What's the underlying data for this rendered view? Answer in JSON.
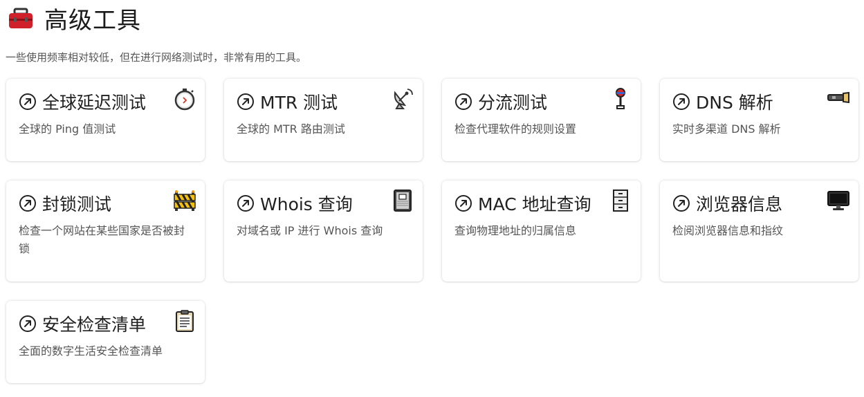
{
  "header": {
    "icon": "toolbox-icon",
    "title": "高级工具",
    "subtitle": "一些使用频率相对较低，但在进行网络测试时，非常有用的工具。"
  },
  "cards": [
    {
      "title": "全球延迟测试",
      "desc": "全球的 Ping 值测试",
      "icon": "stopwatch-icon"
    },
    {
      "title": "MTR 测试",
      "desc": "全球的 MTR 路由测试",
      "icon": "satellite-dish-icon"
    },
    {
      "title": "分流测试",
      "desc": "检查代理软件的规则设置",
      "icon": "round-pushpin-icon"
    },
    {
      "title": "DNS 解析",
      "desc": "实时多渠道 DNS 解析",
      "icon": "flashlight-icon"
    },
    {
      "title": "封锁测试",
      "desc": "检查一个网站在某些国家是否被封锁",
      "icon": "construction-barrier-icon"
    },
    {
      "title": "Whois 查询",
      "desc": "对域名或 IP 进行 Whois 查询",
      "icon": "notebook-icon"
    },
    {
      "title": "MAC 地址查询",
      "desc": "查询物理地址的归属信息",
      "icon": "file-cabinet-icon"
    },
    {
      "title": "浏览器信息",
      "desc": "检阅浏览器信息和指纹",
      "icon": "desktop-computer-icon"
    },
    {
      "title": "安全检查清单",
      "desc": "全面的数字生活安全检查清单",
      "icon": "clipboard-icon"
    }
  ]
}
